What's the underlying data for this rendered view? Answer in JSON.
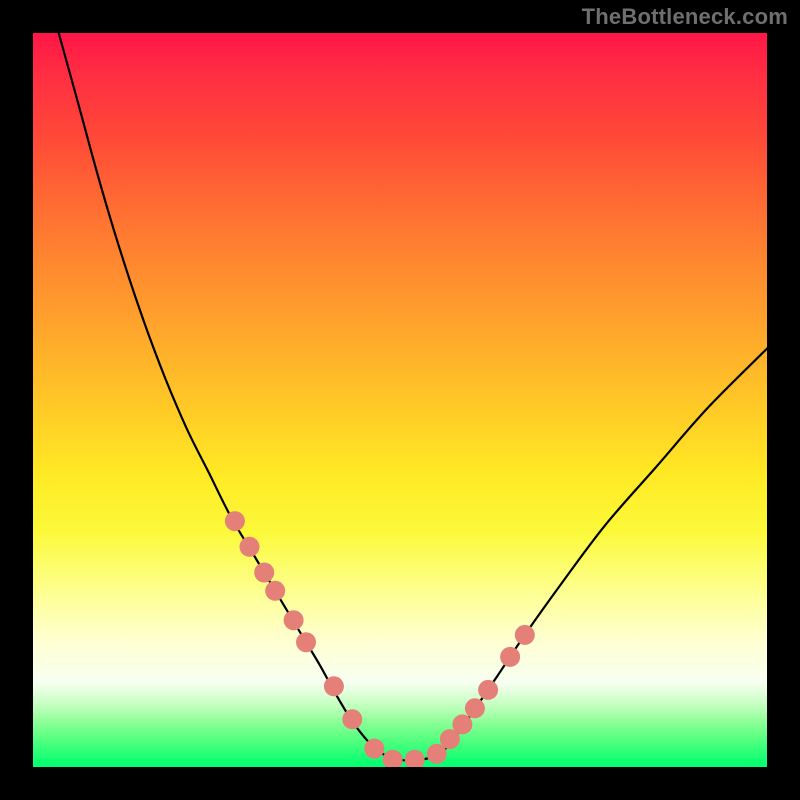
{
  "watermark": "TheBottleneck.com",
  "chart_data": {
    "type": "line",
    "title": "",
    "xlabel": "",
    "ylabel": "",
    "xlim": [
      0,
      100
    ],
    "ylim": [
      0,
      100
    ],
    "grid": false,
    "series": [
      {
        "name": "bottleneck-curve",
        "x": [
          3.5,
          6,
          9,
          12,
          15,
          18,
          21,
          24,
          27,
          30,
          33,
          36,
          39,
          41.5,
          44,
          47,
          50,
          53,
          56,
          59,
          63,
          67,
          72,
          78,
          85,
          92,
          100
        ],
        "values": [
          100,
          91,
          80,
          70,
          61,
          53,
          46,
          40,
          34,
          29,
          24,
          19,
          14,
          9.5,
          5.5,
          2.2,
          1.0,
          1.0,
          2.3,
          6.2,
          12,
          18,
          25,
          33,
          41,
          49,
          57
        ]
      }
    ],
    "markers": {
      "name": "highlight-dots",
      "x": [
        27.5,
        29.5,
        31.5,
        33.0,
        35.5,
        37.2,
        41.0,
        43.5,
        46.5,
        49.0,
        52.0,
        55.0,
        56.8,
        58.5,
        60.2,
        62.0,
        65.0,
        67.0
      ],
      "values": [
        33.5,
        30.0,
        26.5,
        24.0,
        20.0,
        17.0,
        11.0,
        6.5,
        2.5,
        1.0,
        1.0,
        1.8,
        3.8,
        5.8,
        8.0,
        10.5,
        15.0,
        18.0
      ],
      "color": "#e58079",
      "radius": 10
    },
    "background_gradient": {
      "stops": [
        {
          "pos": 0.0,
          "color": "#ff1647"
        },
        {
          "pos": 0.14,
          "color": "#ff4838"
        },
        {
          "pos": 0.32,
          "color": "#ff8a2f"
        },
        {
          "pos": 0.52,
          "color": "#ffcd26"
        },
        {
          "pos": 0.68,
          "color": "#fcf93a"
        },
        {
          "pos": 0.83,
          "color": "#ffffd3"
        },
        {
          "pos": 0.92,
          "color": "#c5ffc0"
        },
        {
          "pos": 1.0,
          "color": "#00ff6f"
        }
      ]
    }
  }
}
